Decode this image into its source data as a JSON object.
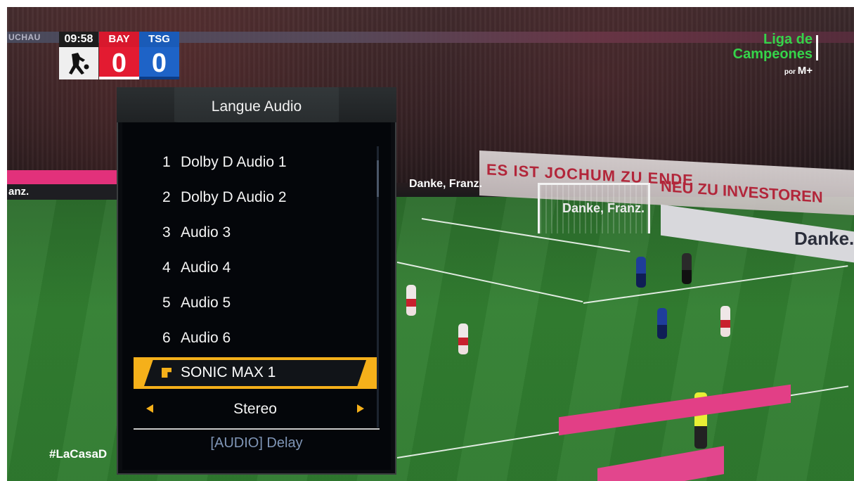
{
  "scoreboard": {
    "clock": "09:58",
    "home": {
      "abbr": "BAY",
      "score": "0"
    },
    "away": {
      "abbr": "TSG",
      "score": "0"
    }
  },
  "channel": {
    "line1": "Liga de",
    "line2": "Campeones",
    "por": "por",
    "brand": "M+"
  },
  "broadcast": {
    "hashtag": "#LaCasaD",
    "board_text": "UCHAU",
    "banner_text": "ES IST JOCHUM ZU ENDE",
    "banner_text_2": "NEU ZU INVESTOREN",
    "danke_left": "Danke, Franz.",
    "danke_right": "Danke.",
    "anz_text": "anz."
  },
  "osd": {
    "title": "Langue Audio",
    "items": [
      {
        "num": "1",
        "label": "Dolby D Audio 1"
      },
      {
        "num": "2",
        "label": "Dolby D Audio 2"
      },
      {
        "num": "3",
        "label": "Audio 3"
      },
      {
        "num": "4",
        "label": "Audio 4"
      },
      {
        "num": "5",
        "label": "Audio 5"
      },
      {
        "num": "6",
        "label": "Audio 6"
      }
    ],
    "selected_label": "SONIC MAX 1",
    "option_value": "Stereo",
    "footer": "[AUDIO] Delay",
    "accent_color": "#f5b01a"
  }
}
